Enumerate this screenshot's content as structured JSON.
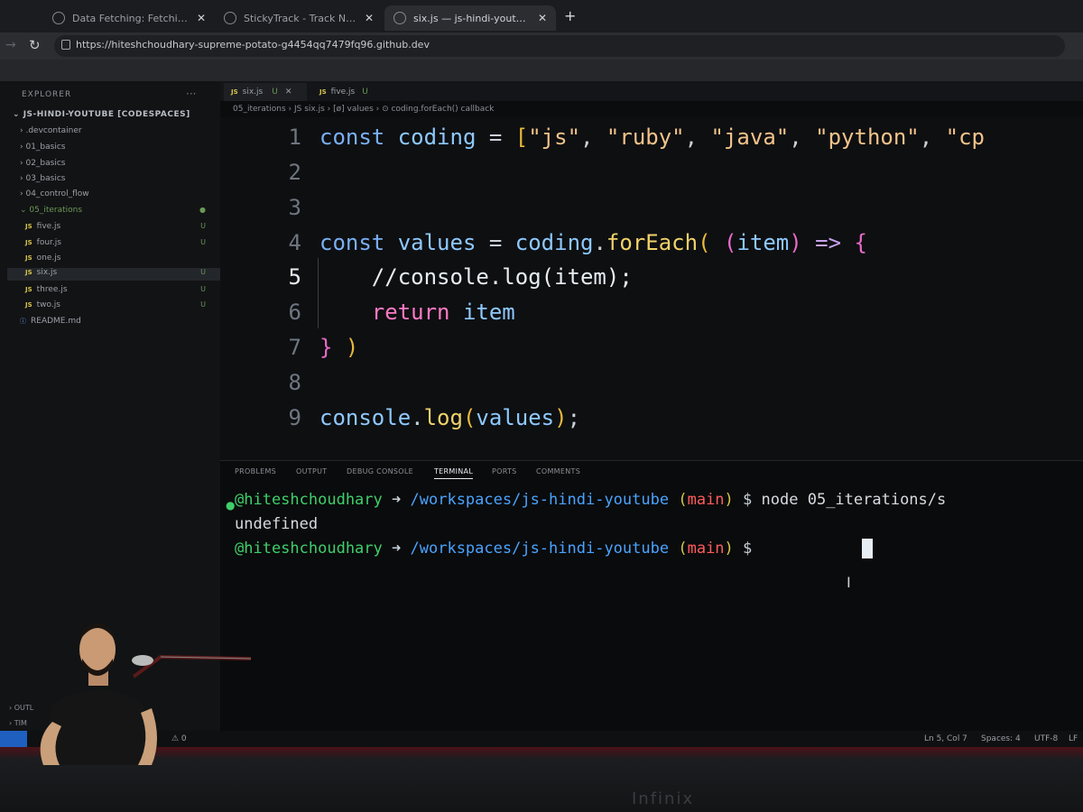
{
  "browser": {
    "tabs": [
      {
        "label": "Data Fetching: Fetching | Nex",
        "active": false
      },
      {
        "label": "StickyTrack - Track Notes, Tra",
        "active": false
      },
      {
        "label": "six.js — js-hindi-youtube [Cod",
        "active": true
      }
    ],
    "url": "https://hiteshchoudhary-supreme-potato-g4454qq7479fq96.github.dev"
  },
  "sidebar": {
    "title": "EXPLORER",
    "workspace": "JS-HINDI-YOUTUBE [CODESPACES]",
    "items": [
      {
        "label": ".devcontainer",
        "type": "folder"
      },
      {
        "label": "01_basics",
        "type": "folder"
      },
      {
        "label": "02_basics",
        "type": "folder"
      },
      {
        "label": "03_basics",
        "type": "folder"
      },
      {
        "label": "04_control_flow",
        "type": "folder"
      },
      {
        "label": "05_iterations",
        "type": "folder",
        "open": true
      },
      {
        "label": "five.js",
        "type": "js",
        "status": "U"
      },
      {
        "label": "four.js",
        "type": "js",
        "status": "U"
      },
      {
        "label": "one.js",
        "type": "js",
        "status": ""
      },
      {
        "label": "six.js",
        "type": "js",
        "status": "U",
        "selected": true
      },
      {
        "label": "three.js",
        "type": "js",
        "status": "U"
      },
      {
        "label": "two.js",
        "type": "js",
        "status": "U"
      },
      {
        "label": "README.md",
        "type": "md",
        "status": ""
      }
    ],
    "outline": "OUTL",
    "timeline": "TIM"
  },
  "editor": {
    "tabs": [
      {
        "label": "six.js",
        "badge": "U",
        "active": true
      },
      {
        "label": "five.js",
        "badge": "U",
        "active": false
      }
    ],
    "breadcrumb": "05_iterations  ›  JS six.js  ›  [ø] values  ›  ⊙ coding.forEach() callback",
    "line_numbers": [
      "1",
      "2",
      "3",
      "4",
      "5",
      "6",
      "7",
      "8",
      "9"
    ],
    "current_line": "5"
  },
  "panel": {
    "tabs": [
      "PROBLEMS",
      "OUTPUT",
      "DEBUG CONSOLE",
      "TERMINAL",
      "PORTS",
      "COMMENTS"
    ],
    "active_tab": "TERMINAL",
    "terminal": {
      "user": "@hiteshchoudhary",
      "path": "/workspaces/js-hindi-youtube",
      "branch": "main",
      "command": "node 05_iterations/s",
      "output": "undefined"
    }
  },
  "statusbar": {
    "left": "⚠ 0",
    "position": "Ln 5, Col 7",
    "spaces": "Spaces: 4",
    "encoding": "UTF-8",
    "eol": "LF"
  },
  "monitor_brand": "Infinix",
  "colors": {
    "terminal_user": "#3fcf6b",
    "terminal_path": "#4aa3ff",
    "terminal_branch": "#ff5b5b",
    "keyword": "#7ab0f5",
    "string": "#f2c38a"
  }
}
